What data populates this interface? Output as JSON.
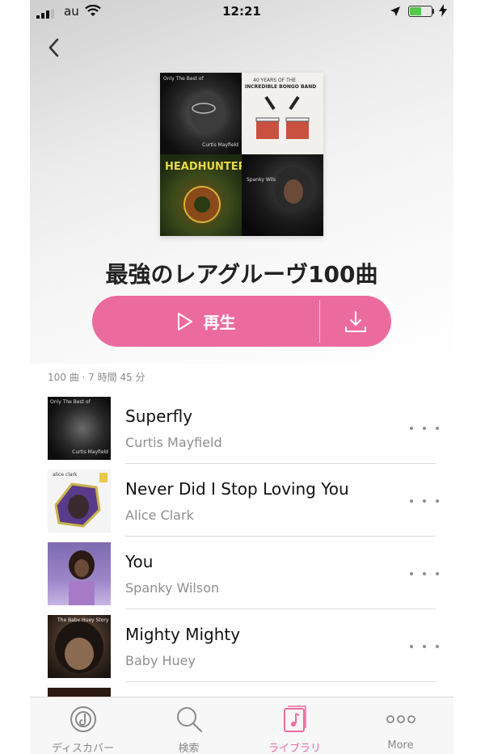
{
  "status_bar": {
    "carrier": "au",
    "time": "12:21",
    "battery_level": 0.55
  },
  "header": {
    "back_icon": "chevron-left-icon"
  },
  "artwork": {
    "tile1_text": "Only The Best of",
    "tile1_artist": "Curtis Mayfield",
    "tile2_text": "40 YEARS OF THE",
    "tile2_title": "INCREDIBLE BONGO BAND",
    "tile3_title": "HEADHUNTERS",
    "tile4_text": "Spanky Wilson"
  },
  "playlist": {
    "title": "最強のレアグルーヴ100曲",
    "play_label": "再生",
    "summary": "100 曲 · 7 時間 45 分"
  },
  "tracks": [
    {
      "title": "Superfly",
      "artist": "Curtis Mayfield",
      "thumb_text": "Only The Best of",
      "thumb_subtext": "Curtis Mayfield"
    },
    {
      "title": "Never Did I Stop Loving You",
      "artist": "Alice Clark",
      "thumb_text": "alice clark",
      "thumb_subtext": ""
    },
    {
      "title": "You",
      "artist": "Spanky Wilson",
      "thumb_text": "",
      "thumb_subtext": ""
    },
    {
      "title": "Mighty Mighty",
      "artist": "Baby Huey",
      "thumb_text": "The Baby Huey Story",
      "thumb_subtext": ""
    }
  ],
  "tab_bar": {
    "tabs": [
      {
        "label": "ディスカバー",
        "icon": "discover-icon",
        "active": false
      },
      {
        "label": "検索",
        "icon": "search-icon",
        "active": false
      },
      {
        "label": "ライブラリ",
        "icon": "library-icon",
        "active": true
      },
      {
        "label": "More",
        "icon": "more-icon",
        "active": false
      }
    ]
  },
  "colors": {
    "accent": "#ec6b9e",
    "text_primary": "#111111",
    "text_secondary": "#8e8e8e"
  }
}
